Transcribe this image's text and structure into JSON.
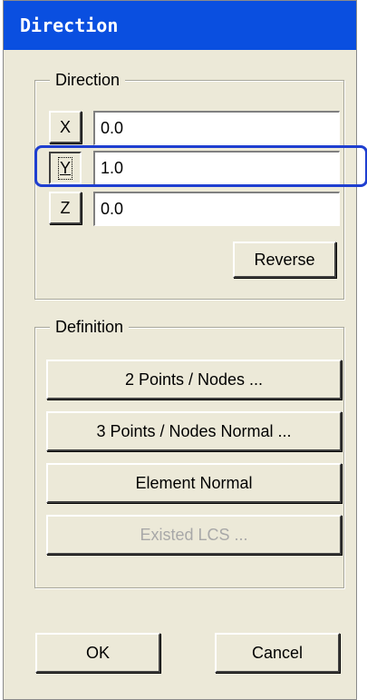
{
  "window": {
    "title": "Direction"
  },
  "direction_group": {
    "title": "Direction",
    "x_label": "X",
    "x_value": "0.0",
    "y_label": "Y",
    "y_value": "1.0",
    "z_label": "Z",
    "z_value": "0.0",
    "reverse_label": "Reverse"
  },
  "definition_group": {
    "title": "Definition",
    "two_points_label": "2 Points / Nodes ...",
    "three_points_label": "3 Points / Nodes Normal ...",
    "element_normal_label": "Element Normal",
    "existed_lcs_label": "Existed LCS ..."
  },
  "footer": {
    "ok_label": "OK",
    "cancel_label": "Cancel"
  },
  "colors": {
    "titlebar": "#0a4fe0",
    "highlight": "#1f3fd0",
    "face": "#ece9d8"
  }
}
